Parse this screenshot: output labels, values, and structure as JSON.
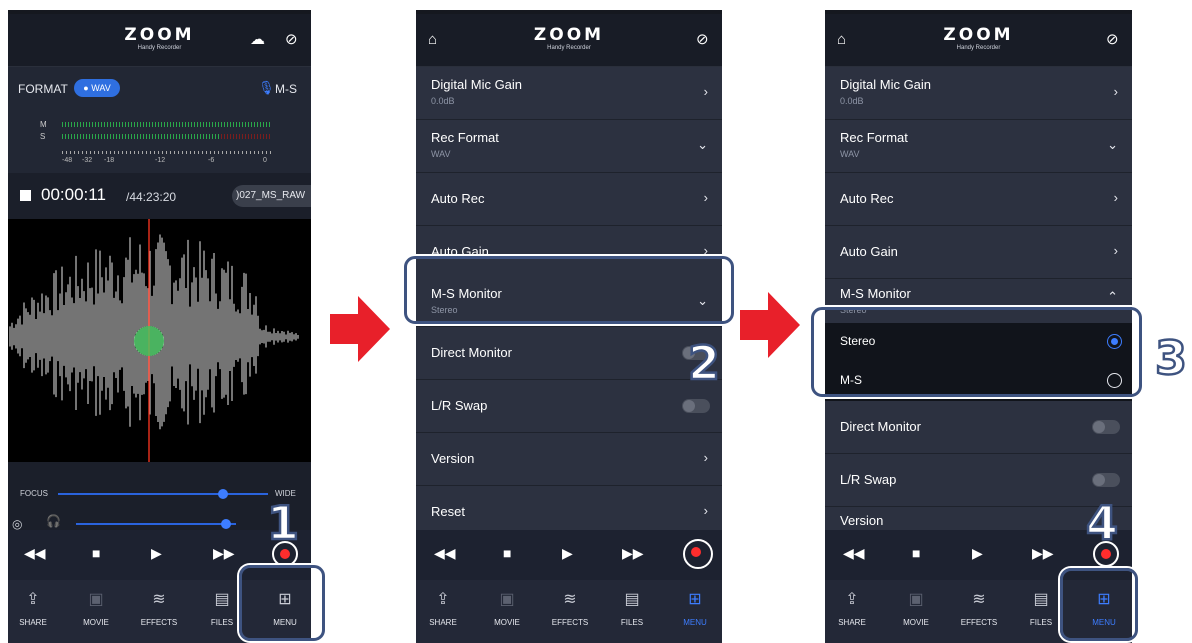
{
  "logo": {
    "brand": "ZOOM",
    "subtitle": "Handy Recorder"
  },
  "icons": {
    "home": "home-icon",
    "rotate": "rotate-icon",
    "cloud": "cloud-icon",
    "mic": "mic-icon",
    "headphones": "headphones-icon"
  },
  "colors": {
    "accent": "#3d7dff",
    "record": "#ff2d2d",
    "callout": "#3e5380",
    "arrow": "#e8202a"
  },
  "recorder": {
    "format_label": "FORMAT",
    "format_value": "WAV",
    "mic_mode": "M-S",
    "meter_channels": [
      "M",
      "S"
    ],
    "meter_scale": [
      "-48",
      "-32",
      "-18",
      "-12",
      "-6",
      "0"
    ],
    "elapsed": "00:00:11",
    "remaining": "/44:23:20",
    "filename": ")027_MS_RAW",
    "focus_label": "FOCUS",
    "wide_label": "WIDE",
    "focus_level": 0.8,
    "volume_level": 0.85
  },
  "menu": {
    "digital_mic_gain": {
      "title": "Digital Mic Gain",
      "value": "0.0dB"
    },
    "rec_format": {
      "title": "Rec Format",
      "value": "WAV"
    },
    "auto_rec": {
      "title": "Auto Rec"
    },
    "auto_gain": {
      "title": "Auto Gain"
    },
    "ms_monitor": {
      "title": "M-S Monitor",
      "value": "Stereo"
    },
    "direct_monitor": {
      "title": "Direct Monitor",
      "on": false
    },
    "lr_swap": {
      "title": "L/R Swap",
      "on": false
    },
    "version": {
      "title": "Version"
    },
    "reset": {
      "title": "Reset"
    },
    "ms_options": [
      {
        "label": "Stereo",
        "selected": true
      },
      {
        "label": "M-S",
        "selected": false
      }
    ]
  },
  "tabs": {
    "share": "SHARE",
    "movie": "MOVIE",
    "effects": "EFFECTS",
    "files": "FILES",
    "menu": "MENU"
  },
  "steps": [
    "1",
    "2",
    "3",
    "4"
  ]
}
